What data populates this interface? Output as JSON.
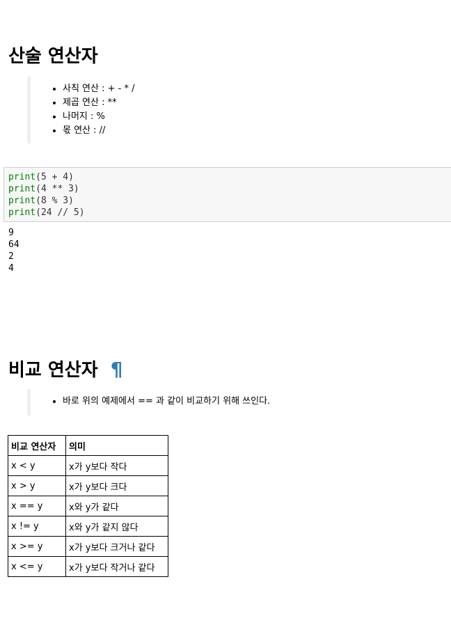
{
  "arithmetic": {
    "heading": "산술 연산자",
    "bullets": [
      "사칙 연산 : + - * /",
      "제곱 연산 : **",
      "나머지 : %",
      "몫 연산 : //"
    ],
    "code": [
      {
        "fn": "print",
        "args": "(5 + 4)"
      },
      {
        "fn": "print",
        "args": "(4 ** 3)"
      },
      {
        "fn": "print",
        "args": "(8 % 3)"
      },
      {
        "fn": "print",
        "args": "(24 // 5)"
      }
    ],
    "output": [
      "9",
      "64",
      "2",
      "4"
    ]
  },
  "comparison": {
    "heading": "비교 연산자",
    "anchor": "¶",
    "bullets": [
      "바로 위의 예제에서 == 과 같이 비교하기 위해 쓰인다."
    ],
    "table": {
      "headers": [
        "비교 연산자",
        "의미"
      ],
      "rows": [
        [
          "x < y",
          "x가 y보다 작다"
        ],
        [
          "x > y",
          "x가 y보다 크다"
        ],
        [
          "x == y",
          "x와 y가 같다"
        ],
        [
          "x != y",
          "x와 y가 같지 않다"
        ],
        [
          "x >= y",
          "x가 y보다 크거나 같다"
        ],
        [
          "x <= y",
          "x가 y보다 작거나 같다"
        ]
      ]
    }
  },
  "colors": {
    "code_keyword": "#008000",
    "anchor_link": "#337ab7",
    "code_background": "#f7f7f7",
    "blockquote_border": "#eeeeee"
  }
}
